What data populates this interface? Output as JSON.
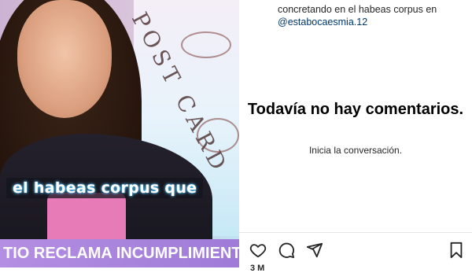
{
  "video": {
    "caption": "el habeas corpus que",
    "ticker": "TIO RECLAMA INCUMPLIMIENTO EN ACUEH",
    "overlay_text": "POST CARD"
  },
  "post": {
    "text": "concretando en el habeas corpus en",
    "mention": "@estabocaesmia.12"
  },
  "comments": {
    "empty_title": "Todavía no hay comentarios.",
    "empty_subtitle": "Inicia la conversación."
  },
  "actions": {
    "icons": [
      "heart-icon",
      "comment-icon",
      "share-icon",
      "bookmark-icon"
    ],
    "likes_partial": "3 M"
  }
}
